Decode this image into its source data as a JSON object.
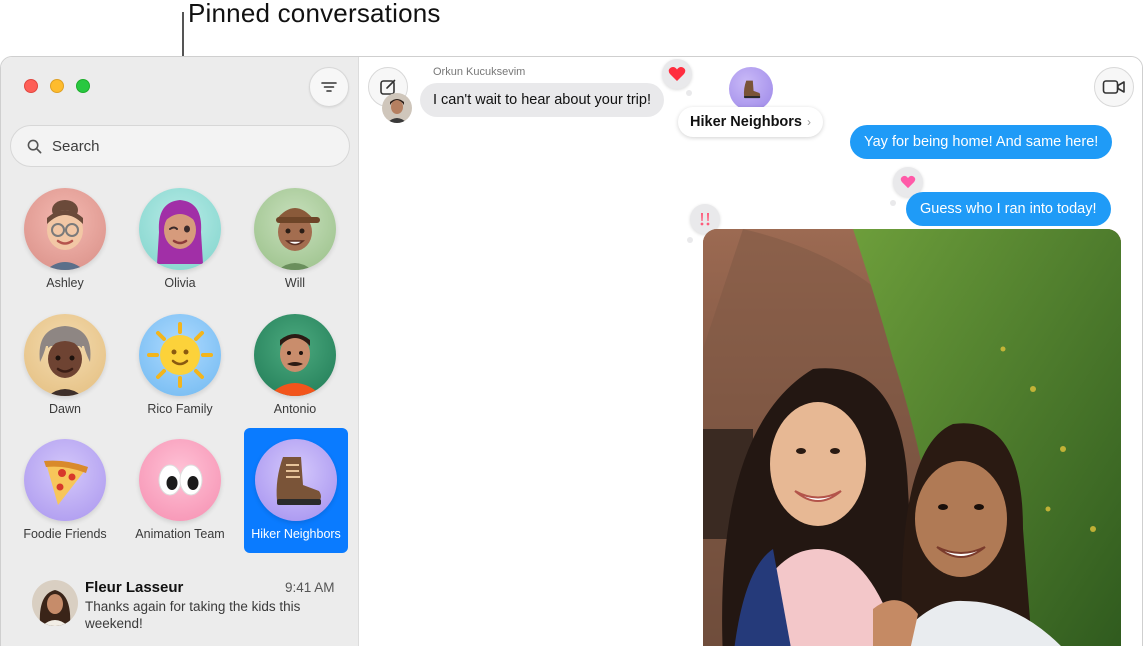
{
  "callout": {
    "text": "Pinned conversations"
  },
  "sidebar": {
    "search_placeholder": "Search",
    "pinned": [
      {
        "name": "Ashley",
        "icon": "memoji-woman-glasses-icon"
      },
      {
        "name": "Olivia",
        "icon": "memoji-woman-purple-hair-icon"
      },
      {
        "name": "Will",
        "icon": "memoji-man-cap-icon"
      },
      {
        "name": "Dawn",
        "icon": "memoji-woman-grey-hair-icon"
      },
      {
        "name": "Rico Family",
        "icon": "sun-face-icon"
      },
      {
        "name": "Antonio",
        "icon": "photo-man-orange-shirt-icon"
      },
      {
        "name": "Foodie Friends",
        "icon": "pizza-icon"
      },
      {
        "name": "Animation Team",
        "icon": "eyes-icon"
      },
      {
        "name": "Hiker Neighbors",
        "icon": "hiking-boot-icon",
        "selected": true
      }
    ],
    "conversation": {
      "name": "Fleur Lasseur",
      "time": "9:41 AM",
      "preview": "Thanks again for taking the kids this weekend!"
    }
  },
  "chat": {
    "group_name": "Hiker Neighbors",
    "sender_name": "Orkun Kucuksevim",
    "incoming_message": "I can't wait to hear about your trip!",
    "outgoing_messages": [
      "Yay for being home! And same here!",
      "Guess who I ran into today!"
    ],
    "tapbacks": [
      "red-heart-icon",
      "pink-heart-icon",
      "exclamation-icon"
    ]
  },
  "colors": {
    "accent": "#0a7bff",
    "outgoing_bubble": "#1f9bf7",
    "incoming_bubble": "#e9e9eb"
  }
}
